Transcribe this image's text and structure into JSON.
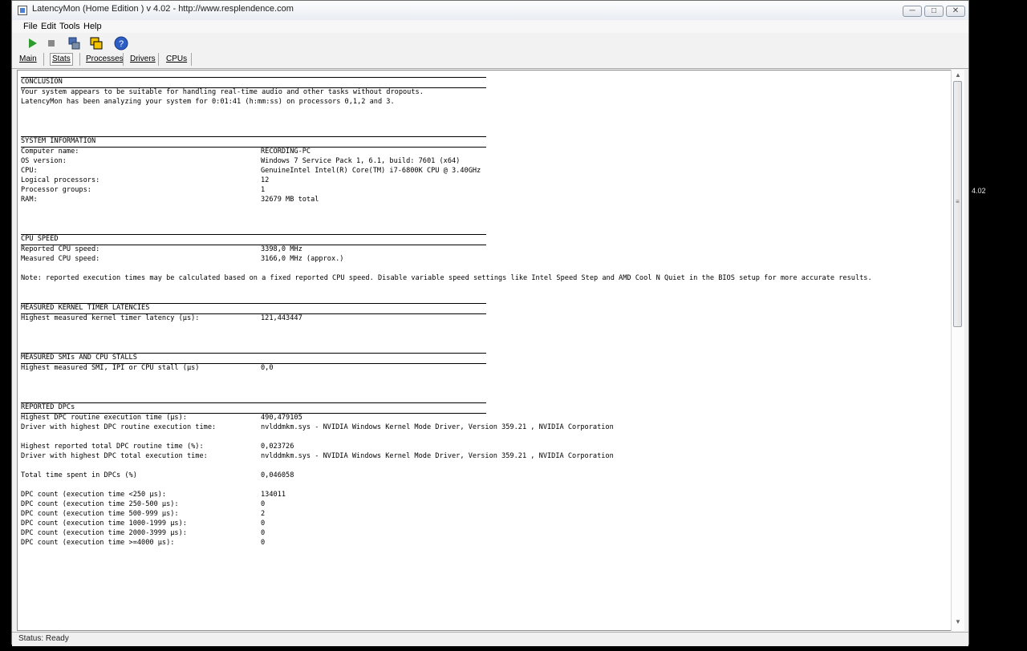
{
  "window": {
    "title": "LatencyMon  (Home Edition )  v 4.02 - http://www.resplendence.com",
    "minimize": "─",
    "maximize": "□",
    "close": "✕"
  },
  "menu": [
    "File",
    "Edit",
    "Tools",
    "Help"
  ],
  "tabs": [
    "Main",
    "Stats",
    "Processes",
    "Drivers",
    "CPUs"
  ],
  "active_tab": "Stats",
  "report": {
    "conclusion": {
      "heading": "CONCLUSION",
      "lines": [
        "Your system appears to be suitable for handling real-time audio and other tasks without dropouts.",
        "LatencyMon has been analyzing your system for  0:01:41  (h:mm:ss) on processors 0,1,2 and 3."
      ]
    },
    "system_information": {
      "heading": "SYSTEM INFORMATION",
      "rows": [
        {
          "label": "Computer name:",
          "value": "RECORDING-PC"
        },
        {
          "label": "OS version:",
          "value": "Windows 7 Service Pack 1, 6.1, build: 7601 (x64)"
        },
        {
          "label": "CPU:",
          "value": "GenuineIntel Intel(R) Core(TM) i7-6800K CPU @ 3.40GHz"
        },
        {
          "label": "Logical processors:",
          "value": "12"
        },
        {
          "label": "Processor groups:",
          "value": "1"
        },
        {
          "label": "RAM:",
          "value": "32679 MB total"
        }
      ]
    },
    "cpu_speed": {
      "heading": "CPU SPEED",
      "rows": [
        {
          "label": "Reported CPU speed:",
          "value": "3398,0 MHz"
        },
        {
          "label": "Measured CPU speed:",
          "value": "3166,0 MHz (approx.)"
        }
      ],
      "note": "Note: reported execution times may be calculated based on a fixed reported CPU speed. Disable variable speed settings like Intel Speed Step and AMD Cool N Quiet in the BIOS setup for more accurate results."
    },
    "kernel_timer": {
      "heading": "MEASURED KERNEL TIMER LATENCIES",
      "rows": [
        {
          "label": "Highest measured kernel timer latency (µs):",
          "value": "121,443447"
        }
      ]
    },
    "smi": {
      "heading": "MEASURED SMIs AND CPU STALLS",
      "rows": [
        {
          "label": "Highest measured SMI, IPI or CPU stall (µs)",
          "value": "0,0"
        }
      ]
    },
    "dpcs": {
      "heading": "REPORTED DPCs",
      "rows_a": [
        {
          "label": "Highest DPC routine execution time (µs):",
          "value": "490,479105"
        },
        {
          "label": "Driver with highest DPC routine execution time:",
          "value": "nvlddmkm.sys - NVIDIA Windows Kernel Mode Driver, Version 359.21 , NVIDIA Corporation"
        }
      ],
      "rows_b": [
        {
          "label": "Highest reported total DPC routine time (%):",
          "value": "0,023726"
        },
        {
          "label": "Driver with highest DPC total execution time:",
          "value": "nvlddmkm.sys - NVIDIA Windows Kernel Mode Driver, Version 359.21 , NVIDIA Corporation"
        }
      ],
      "rows_c": [
        {
          "label": "Total time spent in DPCs (%)",
          "value": "0,046058"
        }
      ],
      "rows_d": [
        {
          "label": "DPC count (execution time <250 µs):",
          "value": "134011"
        },
        {
          "label": "DPC count (execution time 250-500 µs):",
          "value": "0"
        },
        {
          "label": "DPC count (execution time 500-999 µs):",
          "value": "2"
        },
        {
          "label": "DPC count (execution time 1000-1999 µs):",
          "value": "0"
        },
        {
          "label": "DPC count (execution time 2000-3999 µs):",
          "value": "0"
        },
        {
          "label": "DPC count (execution time >=4000 µs):",
          "value": "0"
        }
      ]
    }
  },
  "status": "Status: Ready",
  "outside_text": "4.02",
  "colors": {
    "play": "#2f9b2f",
    "stop": "#8a8a8a",
    "help": "#2c5ec6"
  }
}
